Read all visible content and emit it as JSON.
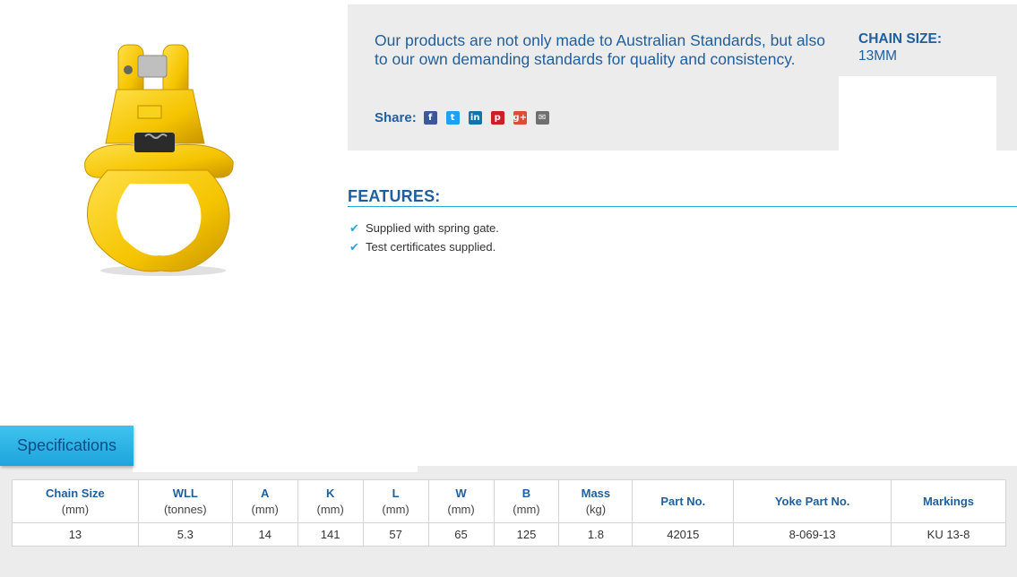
{
  "product": {
    "image_alt": "yellow clevis grab hook coupler",
    "marking": "13-8"
  },
  "intro": {
    "text": "Our products are not only made to Australian Standards, but also to our own demanding standards for quality and consistency."
  },
  "share": {
    "label": "Share:",
    "icons": [
      {
        "name": "facebook-icon",
        "glyph": "f",
        "color": "#3b5998"
      },
      {
        "name": "twitter-icon",
        "glyph": "t",
        "color": "#1da1f2"
      },
      {
        "name": "linkedin-icon",
        "glyph": "in",
        "color": "#0e76a8"
      },
      {
        "name": "pinterest-icon",
        "glyph": "p",
        "color": "#cb2027"
      },
      {
        "name": "google-plus-icon",
        "glyph": "g+",
        "color": "#dd4b39"
      },
      {
        "name": "email-icon",
        "glyph": "✉",
        "color": "#6f6f6f"
      }
    ]
  },
  "chain_size": {
    "label": "CHAIN SIZE:",
    "value": "13MM"
  },
  "features": {
    "title": "FEATURES:",
    "items": [
      "Supplied with spring gate.",
      "Test certificates supplied."
    ]
  },
  "specifications": {
    "tab_label": "Specifications",
    "columns": [
      {
        "header": "Chain Size",
        "unit": "(mm)"
      },
      {
        "header": "WLL",
        "unit": "(tonnes)"
      },
      {
        "header": "A",
        "unit": "(mm)"
      },
      {
        "header": "K",
        "unit": "(mm)"
      },
      {
        "header": "L",
        "unit": "(mm)"
      },
      {
        "header": "W",
        "unit": "(mm)"
      },
      {
        "header": "B",
        "unit": "(mm)"
      },
      {
        "header": "Mass",
        "unit": "(kg)"
      },
      {
        "header": "Part No.",
        "unit": ""
      },
      {
        "header": "Yoke Part No.",
        "unit": ""
      },
      {
        "header": "Markings",
        "unit": ""
      }
    ],
    "rows": [
      [
        "13",
        "5.3",
        "14",
        "141",
        "57",
        "65",
        "125",
        "1.8",
        "42015",
        "8-069-13",
        "KU 13-8"
      ]
    ]
  },
  "colors": {
    "brand_blue": "#1f5f9e",
    "accent_cyan": "#2aa6d9",
    "panel_gray": "#ececec"
  }
}
